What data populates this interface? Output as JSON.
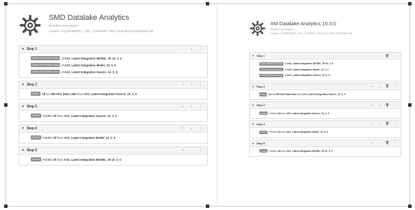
{
  "left": {
    "title": "SMD Datalake Analytics",
    "description": "Workflow Description",
    "creator": "Creator: CQA0RMBR57_AX3_747e8d9b7-76b2-43a4-9b1d-24d98389cc55",
    "steps": [
      {
        "title": "Step 1",
        "controls": [
          "up-disabled",
          "down",
          "more"
        ],
        "rows": [
          {
            "tag": "Delete All Published Data",
            "pre": "of ",
            "bold": "AX3_Latest Integration MODEL_IR 10_3_0"
          },
          {
            "tag": "Delete All Published Data",
            "pre": "of ",
            "bold": "AX3_Latest Integration Model_10_3_0"
          },
          {
            "tag": "Delete All Published Data",
            "pre": "of ",
            "bold": "AX3_Latest Integration Source_10_3_0"
          }
        ]
      },
      {
        "title": "Step 2",
        "controls": [
          "up",
          "down",
          "more"
        ],
        "rows": [
          {
            "tag": "Delete",
            "pre": "",
            "bold": "All",
            "mid": " via ",
            "bold2": "XM Infor Data Lake",
            "mid2": " from ",
            "bold3": "AX3_Latest Integration Source_10_3_0"
          }
        ]
      },
      {
        "title": "Step 3",
        "controls": [
          "up",
          "down",
          "more"
        ],
        "rows": [
          {
            "tag": "Publish",
            "pre": "Publish ",
            "bold": "All",
            "mid": " from ",
            "bold2": "AX3_Latest Integration Source_10_3_0"
          }
        ]
      },
      {
        "title": "Step 4",
        "controls": [
          "up",
          "down",
          "more"
        ],
        "rows": [
          {
            "tag": "Publish",
            "pre": "Publish ",
            "bold": "All",
            "mid": " from ",
            "bold2": "AX3_Latest Integration Model_10_3_0"
          }
        ]
      },
      {
        "title": "Step 5",
        "controls": [
          "up",
          "down-disabled",
          "more"
        ],
        "rows": [
          {
            "tag": "Publish",
            "pre": "Publish ",
            "bold": "All",
            "mid": " from ",
            "bold2": "AX3_Latest Integration MODEL_IR 10_3_0"
          }
        ]
      }
    ]
  },
  "right": {
    "title": "XM Datalake Analytics 10.3.0",
    "description": "Workflow Description",
    "creator": "Creator: CQA0RMBR57_AX3_747e8d9b7-76b2-43a4-9b1d-24d98389cc55",
    "steps": [
      {
        "title": "Step 1",
        "controls": [
          "up-disabled",
          "down",
          "delete",
          "more"
        ],
        "rows": [
          {
            "tag": "Delete All Published Data",
            "pre": "of ",
            "bold": "AX3_Latest Integration MODEL_IR 10_3_0"
          },
          {
            "tag": "Delete All Published Data",
            "pre": "of ",
            "bold": "AX3_Latest Integration Model_10_3_0"
          },
          {
            "tag": "Delete All Published Data",
            "pre": "of ",
            "bold": "AX3_Latest Integration Source_10_3_0"
          }
        ]
      },
      {
        "title": "Step 2",
        "controls": [
          "up",
          "down",
          "delete",
          "more"
        ],
        "rows": [
          {
            "tag": "Delete",
            "pre": "",
            "bold": "All",
            "mid": " via ",
            "bold2": "XM Infor Data Lake",
            "mid2": " from ",
            "bold3": "AX3_Latest Integration Source_10_3_0"
          }
        ]
      },
      {
        "title": "Step 3",
        "controls": [
          "up",
          "down",
          "delete",
          "more"
        ],
        "rows": [
          {
            "tag": "Publish",
            "pre": "Publish ",
            "bold": "All",
            "mid": " from ",
            "bold2": "AX3_Latest Integration Source_10_3_0"
          }
        ]
      },
      {
        "title": "Step 4",
        "controls": [
          "up",
          "down",
          "delete",
          "more"
        ],
        "rows": [
          {
            "tag": "Publish",
            "pre": "Publish ",
            "bold": "All",
            "mid": " from ",
            "bold2": "AX3_Latest Integration Model_10_3_0"
          }
        ]
      },
      {
        "title": "Step 5",
        "controls": [
          "up",
          "down-disabled",
          "delete",
          "more"
        ],
        "rows": [
          {
            "tag": "Publish",
            "pre": "Publish ",
            "bold": "All",
            "mid": " from ",
            "bold2": "AX3_Latest Integration MODEL_IR 10_3_0"
          }
        ]
      }
    ]
  },
  "icons": {
    "logo": "workflow-gear-logo-icon",
    "caret": "caret-down-icon",
    "up": "arrow-up-icon",
    "down": "arrow-down-icon",
    "delete": "trash-icon",
    "more": "more-vertical-icon"
  },
  "colors": {
    "tag_bg": "#8a8a8a",
    "header_bg": "#f4f4f4",
    "border": "#dcdcdc"
  }
}
